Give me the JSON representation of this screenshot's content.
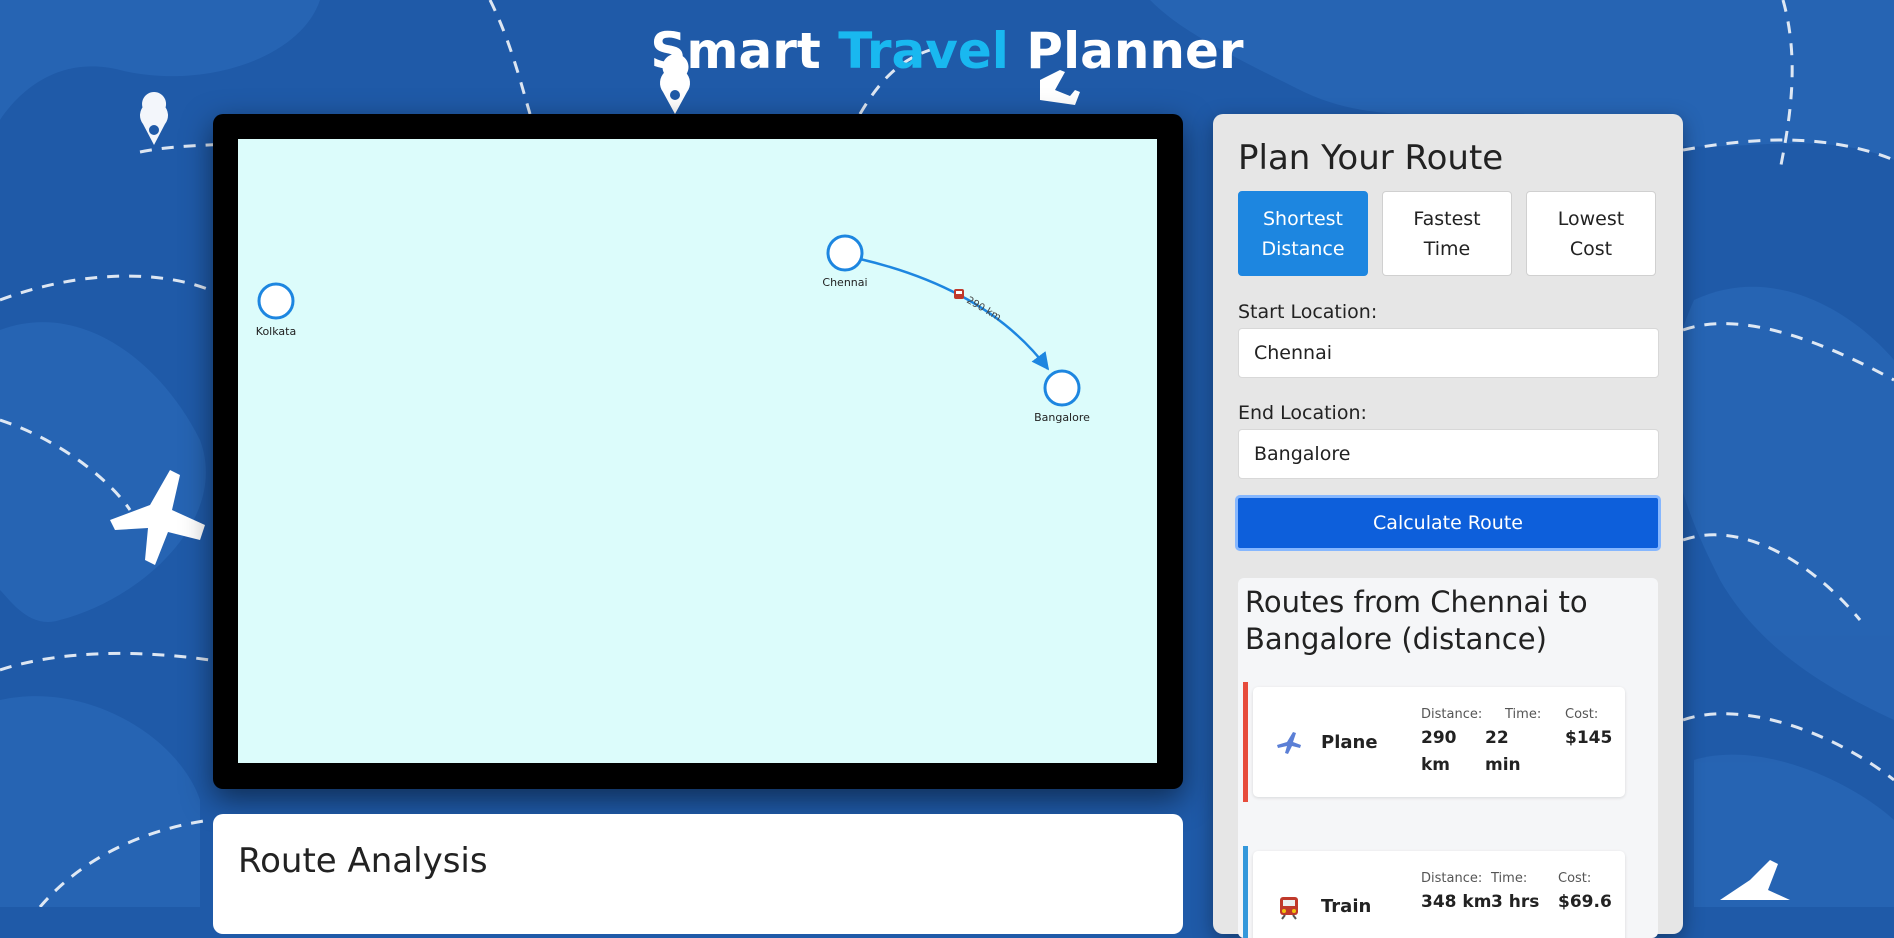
{
  "header": {
    "title_part1": "Smart ",
    "title_accent": "Travel",
    "title_part2": " Planner"
  },
  "colors": {
    "background": "#1f5aa8",
    "accent": "#19b8f0",
    "primary_button": "#0d5fdb",
    "active_mode": "#1d86e0",
    "map_background": "#dcfcfb"
  },
  "map": {
    "nodes": [
      {
        "label": "Kolkata"
      },
      {
        "label": "Chennai"
      },
      {
        "label": "Bangalore"
      }
    ],
    "edge_label": "290 km",
    "edge_icon": "train-icon"
  },
  "analysis": {
    "title": "Route Analysis"
  },
  "planner": {
    "title": "Plan Your Route",
    "modes": [
      {
        "label": "Shortest Distance",
        "active": true
      },
      {
        "label": "Fastest Time",
        "active": false
      },
      {
        "label": "Lowest Cost",
        "active": false
      }
    ],
    "start_label": "Start Location:",
    "start_value": "Chennai",
    "end_label": "End Location:",
    "end_value": "Bangalore",
    "calculate_label": "Calculate Route"
  },
  "results": {
    "title": "Routes from Chennai to Bangalore (distance)",
    "distance_label": "Distance:",
    "time_label": "Time:",
    "cost_label": "Cost:",
    "routes": [
      {
        "mode": "Plane",
        "icon": "plane-icon",
        "color": "#e74c3c",
        "distance": "290 km",
        "time": "22 min",
        "cost": "$145"
      },
      {
        "mode": "Train",
        "icon": "train-icon",
        "color": "#3498db",
        "distance": "348 km",
        "time": "3 hrs",
        "cost": "$69.6"
      }
    ]
  }
}
